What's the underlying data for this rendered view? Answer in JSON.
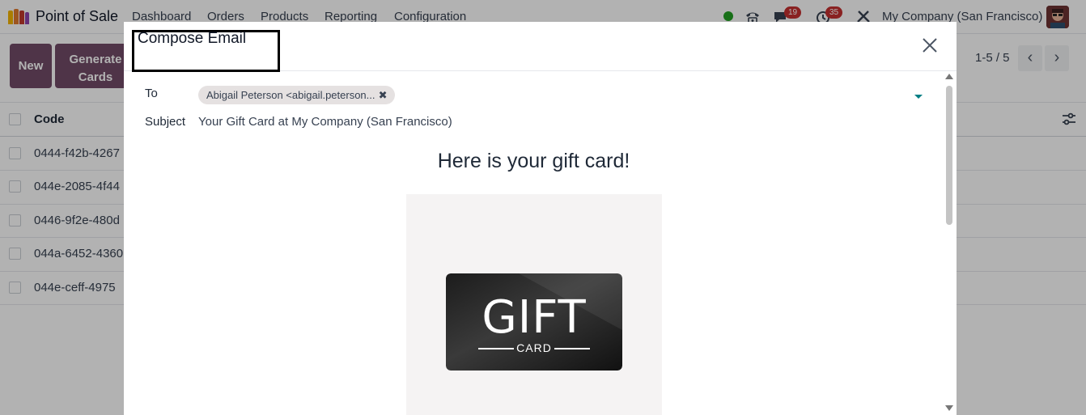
{
  "navbar": {
    "app_name": "Point of Sale",
    "menu": [
      "Dashboard",
      "Orders",
      "Products",
      "Reporting",
      "Configuration"
    ],
    "messages_count": "19",
    "activities_count": "35",
    "company": "My Company (San Francisco)",
    "logo_colors": [
      "#f4b400",
      "#e07a2e",
      "#c0392b",
      "#8e44ad"
    ]
  },
  "control_panel": {
    "new_label": "New",
    "generate_line1": "Generate",
    "generate_line2": "Cards",
    "pager_text": "1-5 / 5",
    "prev_icon": "‹",
    "next_icon": "›"
  },
  "list": {
    "column_code": "Code",
    "rows": [
      {
        "code": "0444-f42b-4267"
      },
      {
        "code": "044e-2085-4f44"
      },
      {
        "code": "0446-9f2e-480d"
      },
      {
        "code": "044a-6452-4360"
      },
      {
        "code": "044e-ceff-4975"
      }
    ]
  },
  "dialog": {
    "title": "Compose Email",
    "to_label": "To",
    "recipient_tag": "Abigail Peterson <abigail.peterson...",
    "remove_icon": "✖",
    "subject_label": "Subject",
    "subject_value": "Your Gift Card at My Company (San Francisco)",
    "body_heading": "Here is your gift card!",
    "gift_word": "GIFT",
    "card_word": "CARD"
  },
  "colors": {
    "primary": "#714b67",
    "accent": "#017e84",
    "badge": "#c53030",
    "online": "#22a022"
  }
}
